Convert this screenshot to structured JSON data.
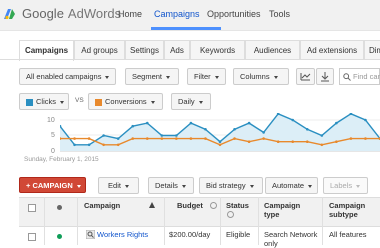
{
  "header": {
    "logo_google": "Google",
    "logo_product": "AdWords",
    "nav": [
      "Home",
      "Campaigns",
      "Opportunities",
      "Tools"
    ]
  },
  "tabs": [
    "Campaigns",
    "Ad groups",
    "Settings",
    "Ads",
    "Keywords",
    "Audiences",
    "Ad extensions",
    "Dim"
  ],
  "toolbar": {
    "filter_campaigns": "All enabled campaigns",
    "segment": "Segment",
    "filter": "Filter",
    "columns": "Columns",
    "search_placeholder": "Find cam"
  },
  "chart_controls": {
    "metric1": "Clicks",
    "vs": "VS",
    "metric2": "Conversions",
    "granularity": "Daily"
  },
  "chart_data": {
    "type": "line",
    "ylabels": [
      "10",
      "5",
      "0"
    ],
    "date_label": "Sunday, February 1, 2015",
    "series": [
      {
        "name": "Clicks",
        "color": "#2a8fc1",
        "fill": "#dceef7",
        "values": [
          8,
          2,
          2,
          5,
          4,
          8,
          9,
          5,
          5,
          9,
          7,
          3,
          7,
          9,
          6,
          12,
          10,
          7,
          5,
          9,
          12,
          10,
          4
        ]
      },
      {
        "name": "Conversions",
        "color": "#e8892c",
        "values": [
          4,
          4,
          4,
          2,
          2,
          4,
          4,
          4,
          4,
          4,
          4,
          2,
          4,
          3,
          4,
          3,
          3,
          3,
          2,
          3,
          4,
          4,
          4
        ]
      }
    ]
  },
  "actions": {
    "new_campaign": "+ CAMPAIGN",
    "edit": "Edit",
    "details": "Details",
    "bid_strategy": "Bid strategy",
    "automate": "Automate",
    "labels": "Labels"
  },
  "table": {
    "headers": [
      "Campaign",
      "Budget",
      "Status",
      "Campaign type",
      "Campaign subtype"
    ],
    "rows": [
      {
        "campaign": "Workers Rights",
        "budget": "$200.00/day",
        "status": "Eligible",
        "type": "Search Network only",
        "subtype": "All features"
      }
    ]
  },
  "colors": {
    "accent": "#4d90fe",
    "red": "#d14836",
    "clicks": "#2a8fc1",
    "conversions": "#e8892c"
  }
}
